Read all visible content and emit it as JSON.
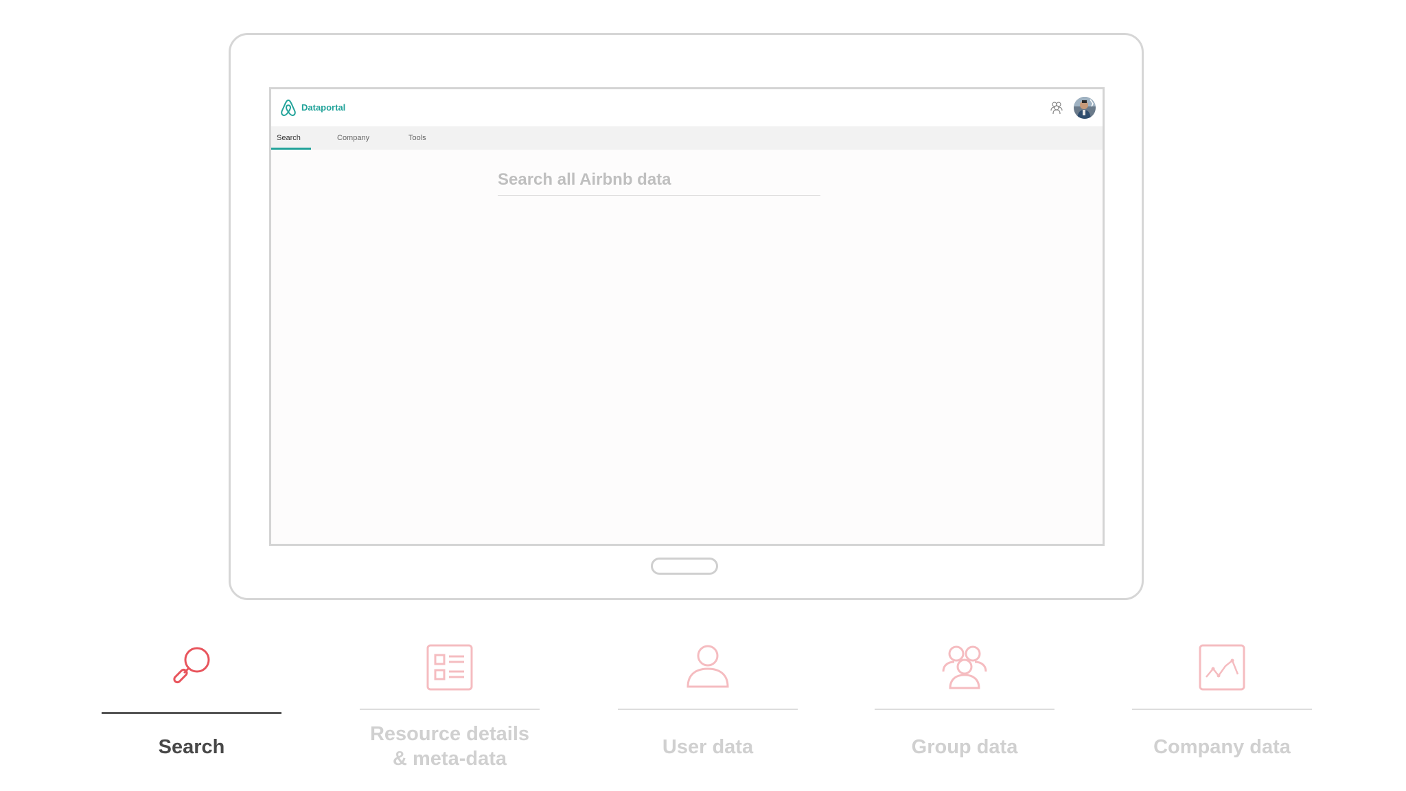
{
  "app": {
    "brand": "Dataportal",
    "tabs": [
      {
        "label": "Search",
        "active": true
      },
      {
        "label": "Company",
        "active": false
      },
      {
        "label": "Tools",
        "active": false
      }
    ],
    "search": {
      "placeholder": "Search all Airbnb data",
      "value": ""
    }
  },
  "steps": [
    {
      "label": "Search",
      "icon": "search-icon",
      "active": true
    },
    {
      "label": "Resource details",
      "label_line2": "& meta-data",
      "icon": "resource-details-icon",
      "active": false
    },
    {
      "label": "User data",
      "icon": "user-icon",
      "active": false
    },
    {
      "label": "Group data",
      "icon": "group-icon",
      "active": false
    },
    {
      "label": "Company data",
      "icon": "company-chart-icon",
      "active": false
    }
  ],
  "colors": {
    "brand": "#22a39a",
    "accent_red": "#e8545c",
    "faded_red": "#f5bcc0",
    "active_label": "#484848",
    "inactive_label": "#d0d0d0"
  }
}
